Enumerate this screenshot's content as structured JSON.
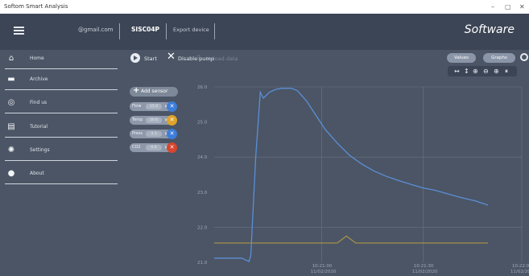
{
  "window": {
    "title": "Softom Smart Analysis",
    "controls": [
      "–",
      "▢",
      "✕"
    ]
  },
  "header": {
    "email": "@gmail.com",
    "device": "SISC04P",
    "device2": "Export device",
    "brand": "Software"
  },
  "sidebar": {
    "items": [
      {
        "label": "Home",
        "icon": "home-icon"
      },
      {
        "label": "Archive",
        "icon": "folder-icon"
      },
      {
        "label": "Find us",
        "icon": "map-pin-icon"
      },
      {
        "label": "Tutorial",
        "icon": "book-icon"
      },
      {
        "label": "Settings",
        "icon": "gear-icon"
      },
      {
        "label": "About",
        "icon": "info-icon"
      }
    ]
  },
  "toolbar": {
    "start_label": "Start",
    "pump_label": "Disable pump",
    "upload_label": "Upload data",
    "values_label": "Values",
    "graphs_label": "Graphs",
    "zoom_controls": [
      "↔",
      "↕",
      "⊕",
      "⊖",
      "⊕",
      "⏸"
    ]
  },
  "series_panel": {
    "add_label": "Add sensor",
    "chips": [
      {
        "name": "Flow",
        "value": "15.0",
        "close": "✕",
        "color": "#3d7ddb"
      },
      {
        "name": "Temp",
        "value": "20.6",
        "close": "✕",
        "color": "#e0a32a"
      },
      {
        "name": "Press",
        "value": "3.3",
        "close": "✕",
        "color": "#3d7ddb"
      },
      {
        "name": "CO2",
        "value": "0.0",
        "close": "✕",
        "color": "#d9452e"
      }
    ]
  },
  "colors": {
    "line_blue": "#5b8fd6",
    "line_gold": "#a48e48",
    "grid": "#6b7587"
  },
  "chart_data": {
    "type": "line",
    "ylabels": [
      "21.0",
      "22.0",
      "23.0",
      "24.0",
      "25.0",
      "26.0"
    ],
    "xlabels": [
      {
        "time": "10:21:00",
        "date": "11/02/2020"
      },
      {
        "time": "10:21:30",
        "date": "11/02/2020"
      },
      {
        "time": "10:22:00",
        "date": "11/02/2020"
      }
    ],
    "ylim": [
      21,
      26
    ],
    "series": [
      {
        "color": "#5b8fd6",
        "points": [
          [
            0.0,
            21.12
          ],
          [
            0.05,
            21.12
          ],
          [
            0.09,
            21.12
          ],
          [
            0.113,
            21.02
          ],
          [
            0.119,
            21.2
          ],
          [
            0.135,
            24.0
          ],
          [
            0.15,
            25.85
          ],
          [
            0.16,
            25.68
          ],
          [
            0.18,
            25.85
          ],
          [
            0.2,
            25.93
          ],
          [
            0.22,
            25.96
          ],
          [
            0.25,
            25.96
          ],
          [
            0.27,
            25.9
          ],
          [
            0.3,
            25.6
          ],
          [
            0.33,
            25.2
          ],
          [
            0.36,
            24.8
          ],
          [
            0.4,
            24.4
          ],
          [
            0.44,
            24.05
          ],
          [
            0.48,
            23.8
          ],
          [
            0.52,
            23.6
          ],
          [
            0.56,
            23.45
          ],
          [
            0.6,
            23.33
          ],
          [
            0.64,
            23.22
          ],
          [
            0.68,
            23.12
          ],
          [
            0.72,
            23.05
          ],
          [
            0.76,
            22.95
          ],
          [
            0.8,
            22.85
          ],
          [
            0.85,
            22.75
          ],
          [
            0.89,
            22.63
          ]
        ]
      },
      {
        "color": "#a48e48",
        "points": [
          [
            0.0,
            21.55
          ],
          [
            0.4,
            21.55
          ],
          [
            0.43,
            21.75
          ],
          [
            0.46,
            21.55
          ],
          [
            0.89,
            21.55
          ]
        ]
      }
    ],
    "grid": true
  }
}
